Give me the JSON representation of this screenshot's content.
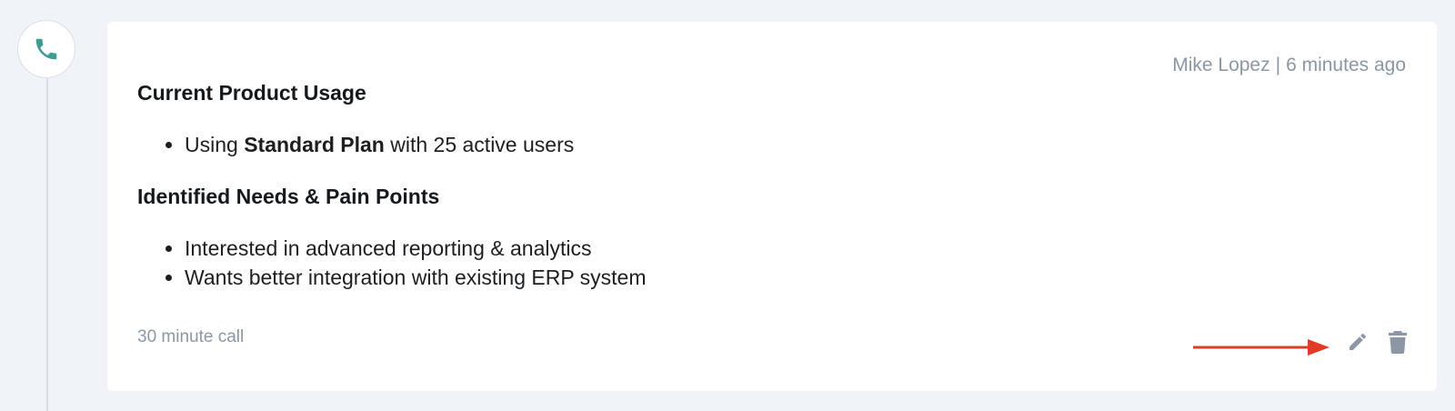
{
  "timeline": {
    "icon": "phone-icon",
    "accent_color": "#3e9a92"
  },
  "card": {
    "meta": {
      "author": "Mike Lopez",
      "separator": "|",
      "time": "6 minutes ago"
    },
    "sections": [
      {
        "heading": "Current Product Usage",
        "items": [
          {
            "prefix": "Using ",
            "bold": "Standard Plan",
            "suffix": " with 25 active users"
          }
        ]
      },
      {
        "heading": "Identified Needs & Pain Points",
        "items": [
          {
            "text": "Interested in advanced reporting & analytics"
          },
          {
            "text": "Wants better integration with existing ERP system"
          }
        ]
      }
    ],
    "footer": {
      "duration": "30 minute call"
    },
    "actions": {
      "edit_icon": "pencil-icon",
      "delete_icon": "trash-icon",
      "icon_color": "#8b97a4"
    }
  },
  "annotation": {
    "arrow_color": "#e23b25",
    "points_to": "edit-button"
  }
}
